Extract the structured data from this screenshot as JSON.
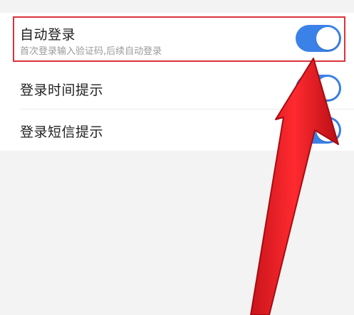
{
  "settings": {
    "auto_login": {
      "title": "自动登录",
      "subtitle": "首次登录输入验证码,后续自动登录",
      "enabled": true
    },
    "login_time_notice": {
      "title": "登录时间提示",
      "enabled": true
    },
    "login_sms_notice": {
      "title": "登录短信提示",
      "enabled": true
    }
  },
  "colors": {
    "toggle_on": "#3b82e8",
    "annotation_red": "#e8262d",
    "background": "#f3f3f3",
    "card": "#ffffff"
  },
  "icons": {
    "annotation": "red-arrow-icon"
  }
}
